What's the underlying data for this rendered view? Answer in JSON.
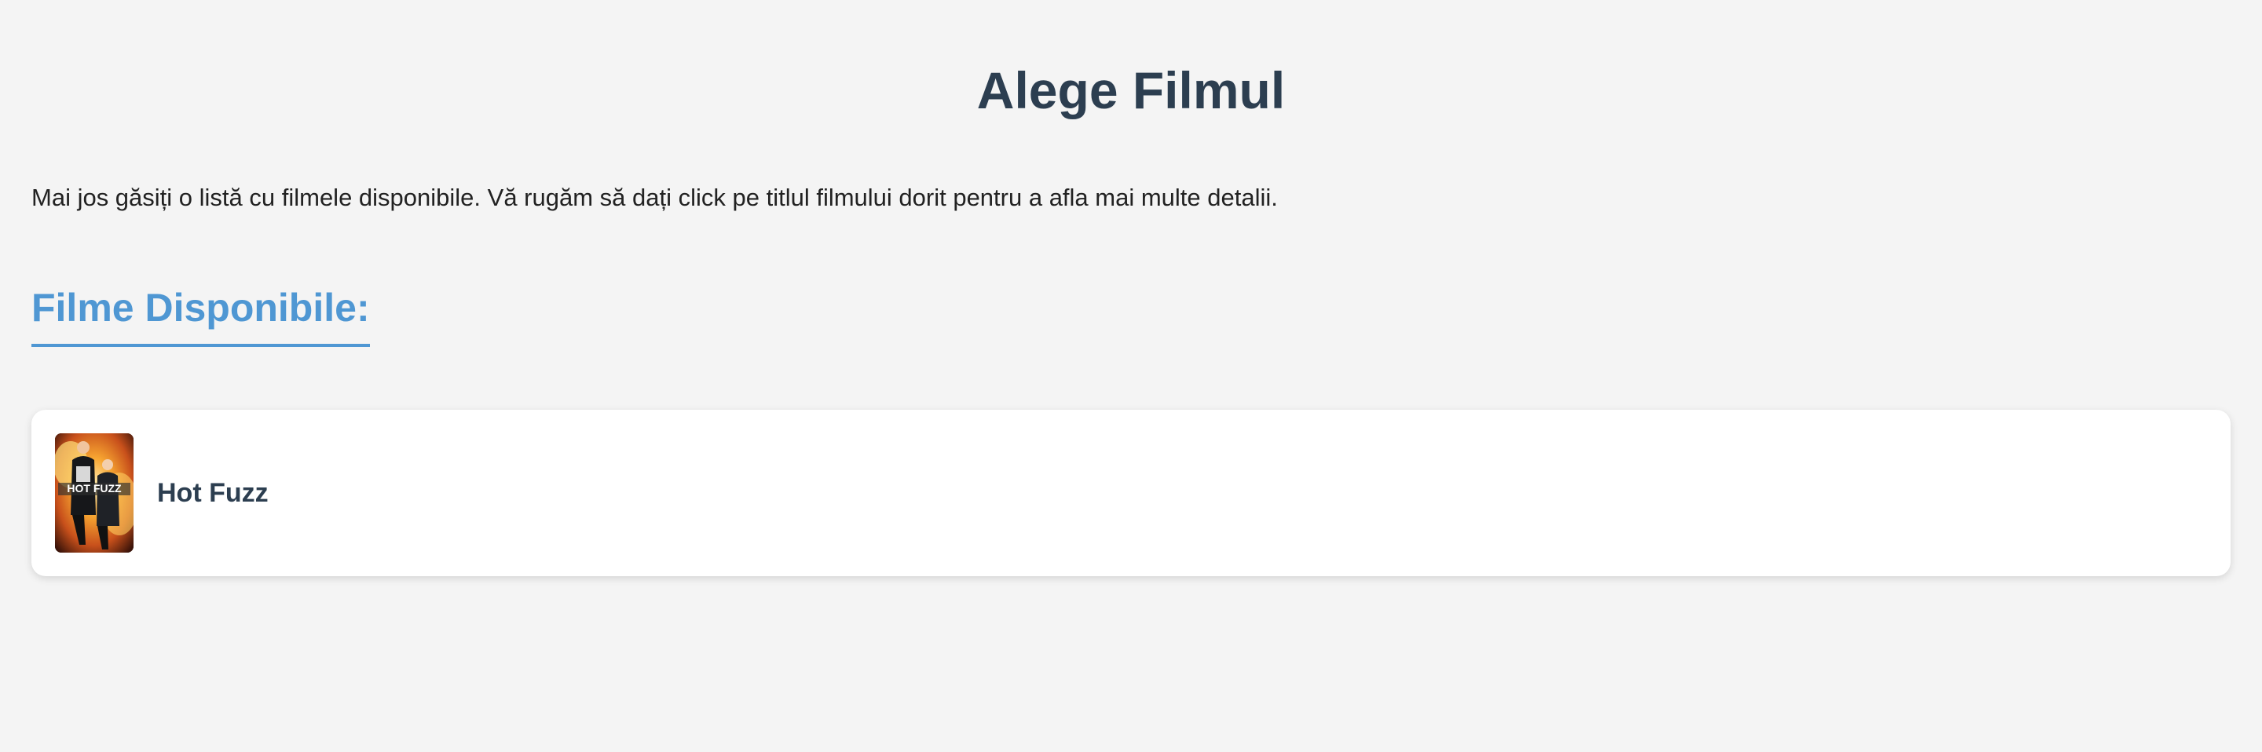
{
  "page": {
    "title": "Alege Filmul",
    "intro": "Mai jos găsiți o listă cu filmele disponibile. Vă rugăm să dați click pe titlul filmului dorit pentru a afla mai multe detalii.",
    "section_heading": "Filme Disponibile:"
  },
  "movies": [
    {
      "title": "Hot Fuzz",
      "poster_text": "HOT FUZZ",
      "poster_icon": "movie-poster-image"
    }
  ],
  "colors": {
    "background": "#f4f4f4",
    "title": "#2c3e50",
    "accent": "#4f97d3",
    "card": "#ffffff"
  }
}
